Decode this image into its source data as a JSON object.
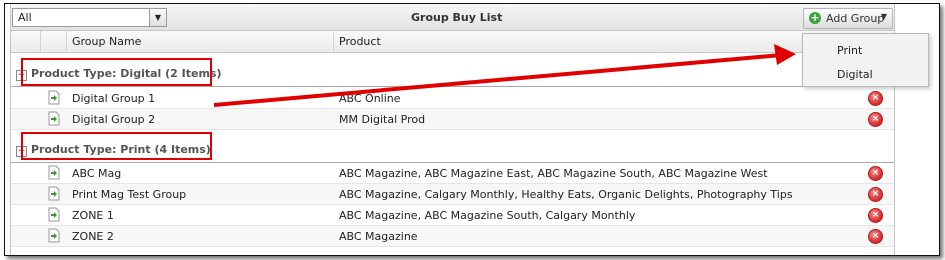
{
  "toolbar": {
    "filter_value": "All",
    "title": "Group Buy List",
    "add_group_label": "Add Group"
  },
  "columns": [
    "Group Name",
    "Product"
  ],
  "add_group_menu": [
    "Print",
    "Digital"
  ],
  "groups": [
    {
      "title": "Product Type: Digital (2 Items)",
      "rows": [
        {
          "name": "Digital Group 1",
          "product": "ABC Online"
        },
        {
          "name": "Digital Group 2",
          "product": "MM Digital Prod"
        }
      ]
    },
    {
      "title": "Product Type: Print (4 Items)",
      "rows": [
        {
          "name": "ABC Mag",
          "product": "ABC Magazine, ABC Magazine East, ABC Magazine South, ABC Magazine West"
        },
        {
          "name": "Print Mag Test Group",
          "product": "ABC Magazine, Calgary Monthly, Healthy Eats, Organic Delights, Photography Tips"
        },
        {
          "name": "ZONE 1",
          "product": "ABC Magazine, ABC Magazine South, Calgary Monthly"
        },
        {
          "name": "ZONE 2",
          "product": "ABC Magazine"
        }
      ]
    }
  ],
  "icons": {
    "row_icon": "document-arrow-icon",
    "delete": "delete-icon",
    "add": "plus-circle-icon",
    "collapse": "collapse-icon"
  },
  "colors": {
    "annotation": "#e00000",
    "delete": "#d12a2a",
    "add": "#3da33d"
  }
}
